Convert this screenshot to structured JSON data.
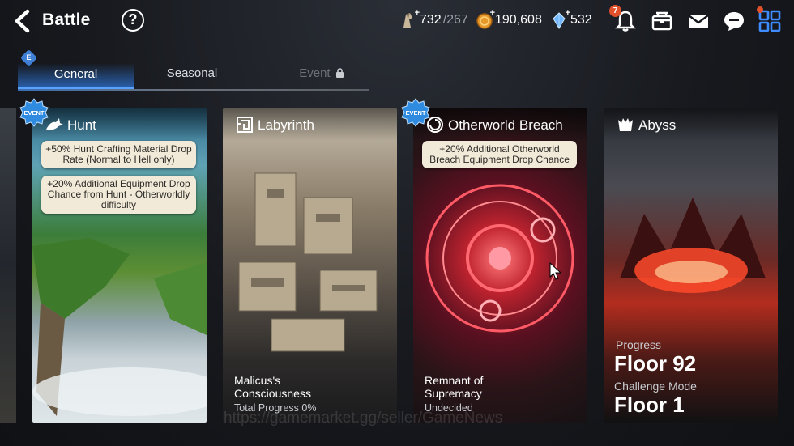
{
  "header": {
    "title": "Battle",
    "help": "?"
  },
  "resources": {
    "stamina": {
      "value": "732",
      "max": "/267",
      "icon": "stamina-icon"
    },
    "gold": {
      "value": "190,608",
      "icon": "gold-coin-icon"
    },
    "skystone": {
      "value": "532",
      "icon": "crystal-icon"
    },
    "notification_count": "7"
  },
  "tabs": {
    "badge": "E",
    "general": "General",
    "seasonal": "Seasonal",
    "event": "Event"
  },
  "cards": [
    {
      "name": "Hunt",
      "event_badge": "EVENT",
      "notes": [
        "+50% Hunt Crafting Material Drop Rate (Normal to Hell only)",
        "+20% Additional Equipment Drop Chance from Hunt - Otherworldly difficulty"
      ]
    },
    {
      "name": "Labyrinth",
      "footer_title": "Malicus's Consciousness",
      "footer_sub": "Total Progress 0%"
    },
    {
      "name": "Otherworld Breach",
      "event_badge": "EVENT",
      "notes": [
        "+20% Additional Otherworld Breach Equipment Drop Chance"
      ],
      "footer_title": "Remnant of Supremacy",
      "footer_sub": "Undecided"
    },
    {
      "name": "Abyss",
      "progress_label": "Progress",
      "progress_value": "Floor 92",
      "challenge_label": "Challenge Mode",
      "challenge_value": "Floor 1"
    }
  ],
  "watermark": "https://gamemarket.gg/seller/GameNews",
  "colors": {
    "accent": "#5aa2ff",
    "note_bg": "#f1ead9",
    "badge": "#e0512b"
  }
}
